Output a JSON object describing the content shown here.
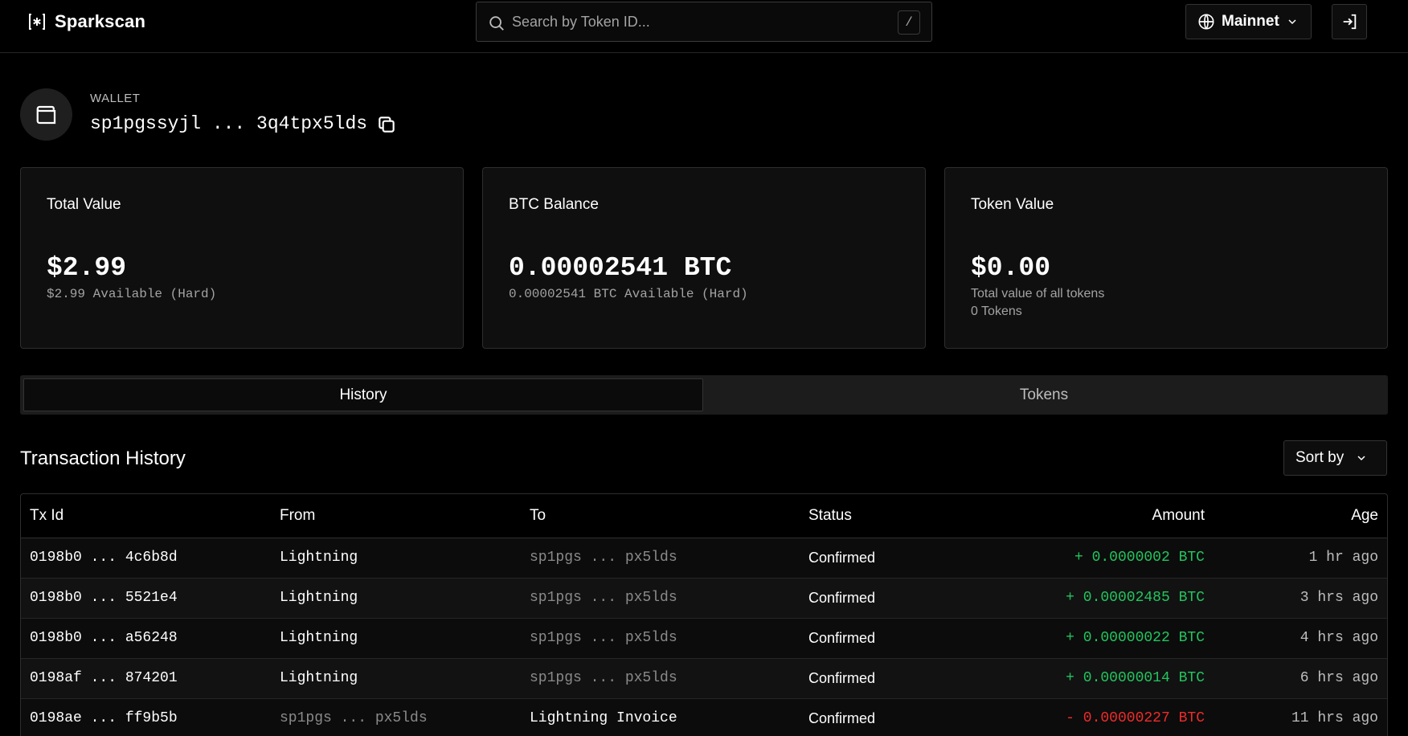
{
  "app": {
    "name": "Sparkscan"
  },
  "search": {
    "placeholder": "Search by Token ID...",
    "shortcut": "/"
  },
  "network": {
    "label": "Mainnet"
  },
  "wallet": {
    "label": "WALLET",
    "address": "sp1pgssyjl ... 3q4tpx5lds"
  },
  "cards": {
    "total": {
      "title": "Total Value",
      "value": "$2.99",
      "sub": "$2.99 Available (Hard)"
    },
    "btc": {
      "title": "BTC Balance",
      "value": "0.00002541 BTC",
      "sub": "0.00002541 BTC Available (Hard)"
    },
    "token": {
      "title": "Token Value",
      "value": "$0.00",
      "sub1": "Total value of all tokens",
      "sub2": "0 Tokens"
    }
  },
  "tabs": {
    "history": "History",
    "tokens": "Tokens"
  },
  "history": {
    "title": "Transaction History",
    "sort_label": "Sort by",
    "columns": {
      "txid": "Tx Id",
      "from": "From",
      "to": "To",
      "status": "Status",
      "amount": "Amount",
      "age": "Age"
    },
    "rows": [
      {
        "txid": "0198b0 ... 4c6b8d",
        "from": "Lightning",
        "to": "sp1pgs ... px5lds",
        "status": "Confirmed",
        "sign": "+",
        "amount": "0.0000002 BTC",
        "age": "1 hr ago"
      },
      {
        "txid": "0198b0 ... 5521e4",
        "from": "Lightning",
        "to": "sp1pgs ... px5lds",
        "status": "Confirmed",
        "sign": "+",
        "amount": "0.00002485 BTC",
        "age": "3 hrs ago"
      },
      {
        "txid": "0198b0 ... a56248",
        "from": "Lightning",
        "to": "sp1pgs ... px5lds",
        "status": "Confirmed",
        "sign": "+",
        "amount": "0.00000022 BTC",
        "age": "4 hrs ago"
      },
      {
        "txid": "0198af ... 874201",
        "from": "Lightning",
        "to": "sp1pgs ... px5lds",
        "status": "Confirmed",
        "sign": "+",
        "amount": "0.00000014 BTC",
        "age": "6 hrs ago"
      },
      {
        "txid": "0198ae ... ff9b5b",
        "from": "sp1pgs ... px5lds",
        "to": "Lightning Invoice",
        "status": "Confirmed",
        "sign": "-",
        "amount": "0.00000227 BTC",
        "age": "11 hrs ago"
      }
    ]
  },
  "colors": {
    "positive": "#22c55e",
    "negative": "#ef2b2b",
    "background": "#000000"
  }
}
